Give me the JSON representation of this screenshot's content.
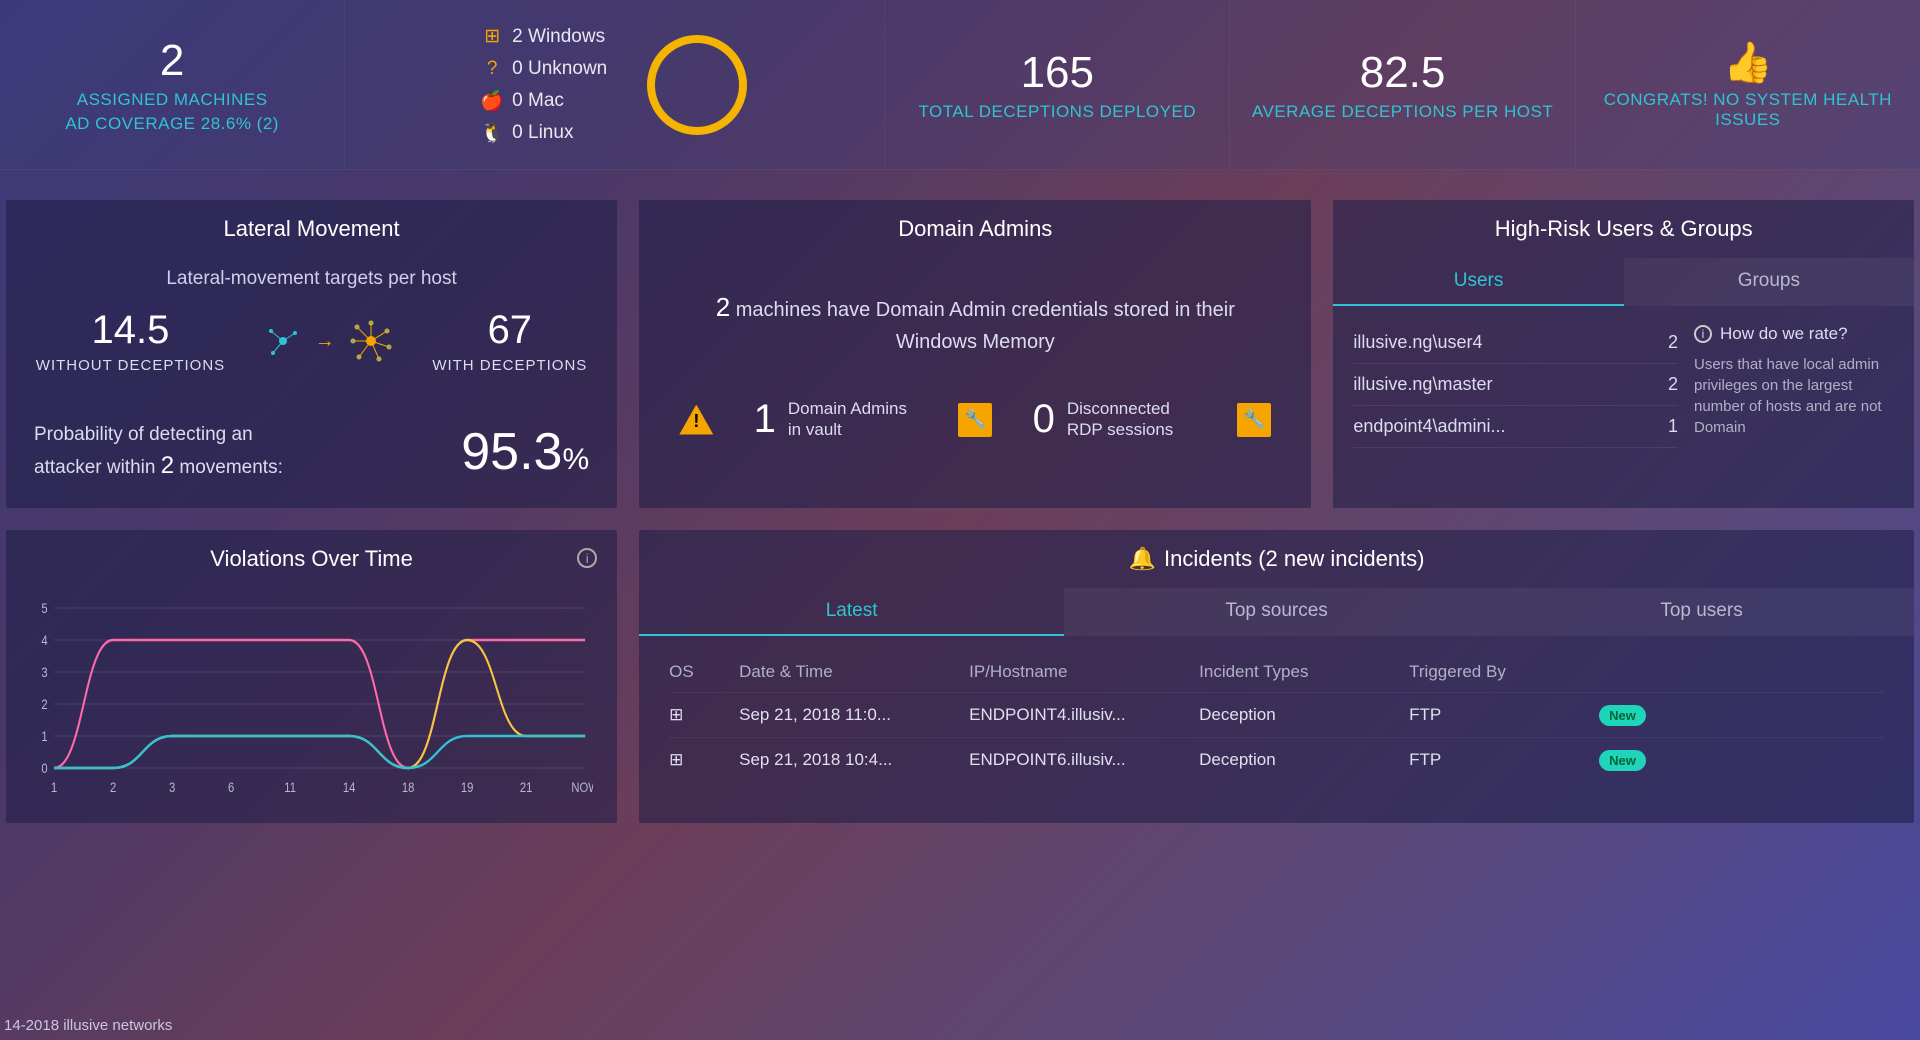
{
  "top": {
    "assigned_count": "2",
    "assigned_label": "ASSIGNED MACHINES",
    "ad_coverage": "AD COVERAGE 28.6% (2)",
    "os": {
      "windows": "2 Windows",
      "unknown": "0 Unknown",
      "mac": "0 Mac",
      "linux": "0 Linux"
    },
    "total_deceptions": "165",
    "total_deceptions_label": "TOTAL DECEPTIONS DEPLOYED",
    "avg_deceptions": "82.5",
    "avg_deceptions_label": "AVERAGE DECEPTIONS PER HOST",
    "health_label": "CONGRATS! NO SYSTEM HEALTH ISSUES"
  },
  "lateral": {
    "title": "Lateral Movement",
    "subtitle": "Lateral-movement targets per host",
    "without_num": "14.5",
    "without_label": "WITHOUT DECEPTIONS",
    "with_num": "67",
    "with_label": "WITH DECEPTIONS",
    "prob_text_1": "Probability of detecting an attacker within ",
    "prob_moves": "2",
    "prob_text_2": " movements:",
    "prob_value": "95.3",
    "prob_pct": "%"
  },
  "domain_admins": {
    "title": "Domain Admins",
    "msg_num": "2",
    "msg_text": " machines have Domain Admin credentials stored in their Windows Memory",
    "vault_num": "1",
    "vault_label": "Domain Admins in vault",
    "rdp_num": "0",
    "rdp_label": "Disconnected RDP sessions"
  },
  "high_risk": {
    "title": "High-Risk Users & Groups",
    "tab_users": "Users",
    "tab_groups": "Groups",
    "rows": [
      {
        "name": "illusive.ng\\user4",
        "count": "2"
      },
      {
        "name": "illusive.ng\\master",
        "count": "2"
      },
      {
        "name": "endpoint4\\admini...",
        "count": "1"
      }
    ],
    "rate_q": "How do we rate?",
    "rate_text": "Users that have local admin privileges on the largest number of hosts and are not Domain"
  },
  "violations": {
    "title": "Violations Over Time"
  },
  "chart_data": {
    "type": "line",
    "title": "Violations Over Time",
    "xlabel": "",
    "ylabel": "",
    "ylim": [
      0,
      5
    ],
    "x_categories": [
      "1",
      "2",
      "3",
      "6",
      "11",
      "14",
      "18",
      "19",
      "21",
      "NOW"
    ],
    "y_ticks": [
      0,
      1,
      2,
      3,
      4,
      5
    ],
    "series": [
      {
        "name": "pink",
        "color": "#ff6aa8",
        "values": [
          0,
          4,
          4,
          4,
          4,
          4,
          0,
          4,
          4,
          4
        ]
      },
      {
        "name": "yellow",
        "color": "#f5c542",
        "values": [
          0,
          0,
          1,
          1,
          1,
          1,
          0,
          4,
          1,
          1
        ]
      },
      {
        "name": "teal",
        "color": "#2fc3d4",
        "values": [
          0,
          0,
          1,
          1,
          1,
          1,
          0,
          1,
          1,
          1
        ]
      }
    ]
  },
  "incidents": {
    "title": "Incidents (2 new incidents)",
    "tab_latest": "Latest",
    "tab_sources": "Top sources",
    "tab_users": "Top users",
    "head": {
      "os": "OS",
      "dt": "Date & Time",
      "ip": "IP/Hostname",
      "type": "Incident Types",
      "trig": "Triggered By"
    },
    "rows": [
      {
        "dt": "Sep 21, 2018 11:0...",
        "ip": "ENDPOINT4.illusiv...",
        "type": "Deception",
        "trig": "FTP",
        "badge": "New"
      },
      {
        "dt": "Sep 21, 2018 10:4...",
        "ip": "ENDPOINT6.illusiv...",
        "type": "Deception",
        "trig": "FTP",
        "badge": "New"
      }
    ]
  },
  "footer": "14-2018 illusive networks"
}
